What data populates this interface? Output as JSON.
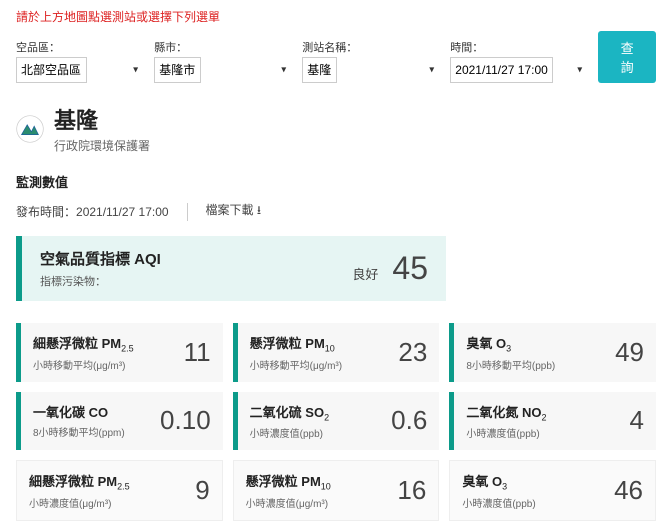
{
  "notice": "請於上方地圖點選測站或選擇下列選單",
  "filters": {
    "region": {
      "label": "空品區：",
      "value": "北部空品區"
    },
    "county": {
      "label": "縣市：",
      "value": "基隆市"
    },
    "station": {
      "label": "測站名稱：",
      "value": "基隆"
    },
    "time": {
      "label": "時間：",
      "value": "2021/11/27 17:00"
    }
  },
  "query_btn": "查詢",
  "station": {
    "name": "基隆",
    "agency": "行政院環境保護署"
  },
  "section_title": "監測數值",
  "publish": {
    "label": "發布時間：",
    "value": "2021/11/27 17:00"
  },
  "download": "檔案下載",
  "aqi": {
    "title": "空氣品質指標 AQI",
    "sub": "指標污染物：",
    "status": "良好",
    "value": "45"
  },
  "cards": [
    {
      "name": "細懸浮微粒 PM",
      "sub": "2.5",
      "unit": "小時移動平均(μg/m³)",
      "value": "11",
      "accent": true
    },
    {
      "name": "懸浮微粒 PM",
      "sub": "10",
      "unit": "小時移動平均(μg/m³)",
      "value": "23",
      "accent": true
    },
    {
      "name": "臭氧 O",
      "sub": "3",
      "unit": "8小時移動平均(ppb)",
      "value": "49",
      "accent": true
    },
    {
      "name": "一氧化碳 CO",
      "sub": "",
      "unit": "8小時移動平均(ppm)",
      "value": "0.10",
      "accent": true
    },
    {
      "name": "二氧化硫 SO",
      "sub": "2",
      "unit": "小時濃度值(ppb)",
      "value": "0.6",
      "accent": true
    },
    {
      "name": "二氧化氮 NO",
      "sub": "2",
      "unit": "小時濃度值(ppb)",
      "value": "4",
      "accent": true
    },
    {
      "name": "細懸浮微粒 PM",
      "sub": "2.5",
      "unit": "小時濃度值(μg/m³)",
      "value": "9",
      "accent": false
    },
    {
      "name": "懸浮微粒 PM",
      "sub": "10",
      "unit": "小時濃度值(μg/m³)",
      "value": "16",
      "accent": false
    },
    {
      "name": "臭氧 O",
      "sub": "3",
      "unit": "小時濃度值(ppb)",
      "value": "46",
      "accent": false
    }
  ]
}
